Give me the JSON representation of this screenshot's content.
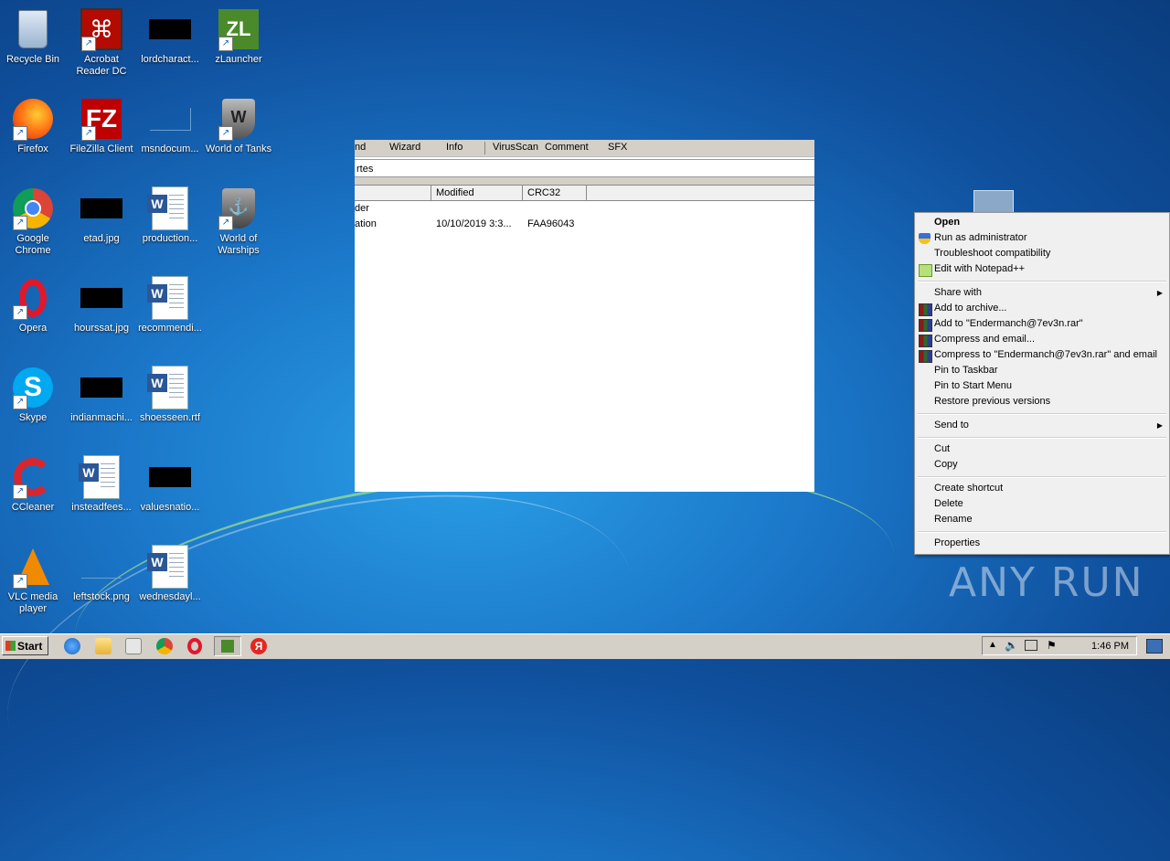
{
  "desktop": {
    "icons": [
      {
        "label": "Recycle Bin"
      },
      {
        "label": "Acrobat Reader DC"
      },
      {
        "label": "lordcharact..."
      },
      {
        "label": "zLauncher"
      },
      {
        "label": "Firefox"
      },
      {
        "label": "FileZilla Client"
      },
      {
        "label": "msndocum..."
      },
      {
        "label": "World of Tanks"
      },
      {
        "label": "Google Chrome"
      },
      {
        "label": "etad.jpg"
      },
      {
        "label": "production..."
      },
      {
        "label": "World of Warships"
      },
      {
        "label": "Opera"
      },
      {
        "label": "hourssat.jpg"
      },
      {
        "label": "recommendi..."
      },
      {
        "label": "Skype"
      },
      {
        "label": "indianmachi..."
      },
      {
        "label": "shoesseen.rtf"
      },
      {
        "label": "CCleaner"
      },
      {
        "label": "insteadfees..."
      },
      {
        "label": "valuesnatio..."
      },
      {
        "label": "VLC media player"
      },
      {
        "label": "leftstock.png"
      },
      {
        "label": "wednesdayl..."
      }
    ]
  },
  "archive_window": {
    "menu": [
      "nd",
      "Wizard",
      "Info",
      "VirusScan",
      "Comment",
      "SFX"
    ],
    "address": "rtes",
    "columns": [
      "Modified",
      "CRC32"
    ],
    "rows": [
      {
        "name": "der",
        "modified": "",
        "crc": ""
      },
      {
        "name": "ation",
        "modified": "10/10/2019 3:3...",
        "crc": "FAA96043"
      }
    ]
  },
  "context_menu": {
    "open": "Open",
    "run_admin": "Run as administrator",
    "troubleshoot": "Troubleshoot compatibility",
    "edit_npp": "Edit with Notepad++",
    "share_with": "Share with",
    "add_archive": "Add to archive...",
    "add_rar": "Add to \"Endermanch@7ev3n.rar\"",
    "compress_email": "Compress and email...",
    "compress_rar_email": "Compress to \"Endermanch@7ev3n.rar\" and email",
    "pin_taskbar": "Pin to Taskbar",
    "pin_start": "Pin to Start Menu",
    "restore": "Restore previous versions",
    "send_to": "Send to",
    "cut": "Cut",
    "copy": "Copy",
    "create_shortcut": "Create shortcut",
    "delete": "Delete",
    "rename": "Rename",
    "properties": "Properties"
  },
  "taskbar": {
    "start_label": "Start",
    "clock": "1:46 PM"
  },
  "watermark": "ANY RUN"
}
